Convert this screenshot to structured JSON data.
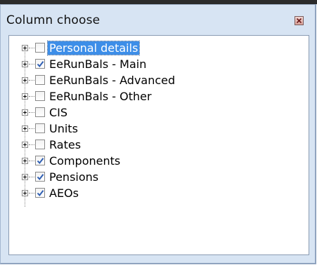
{
  "window": {
    "title": "Column choose",
    "close_icon": "close-icon"
  },
  "tree": {
    "items": [
      {
        "label": "Personal details",
        "checked": false,
        "selected": true
      },
      {
        "label": "EeRunBals - Main",
        "checked": true,
        "selected": false
      },
      {
        "label": "EeRunBals - Advanced",
        "checked": false,
        "selected": false
      },
      {
        "label": "EeRunBals - Other",
        "checked": false,
        "selected": false
      },
      {
        "label": "CIS",
        "checked": false,
        "selected": false
      },
      {
        "label": "Units",
        "checked": false,
        "selected": false
      },
      {
        "label": "Rates",
        "checked": false,
        "selected": false
      },
      {
        "label": "Components",
        "checked": true,
        "selected": false
      },
      {
        "label": "Pensions",
        "checked": true,
        "selected": false
      },
      {
        "label": "AEOs",
        "checked": true,
        "selected": false
      }
    ]
  },
  "colors": {
    "panel_bg": "#d7e4f3",
    "selection": "#3d8ee8",
    "check": "#2f5fb3"
  }
}
